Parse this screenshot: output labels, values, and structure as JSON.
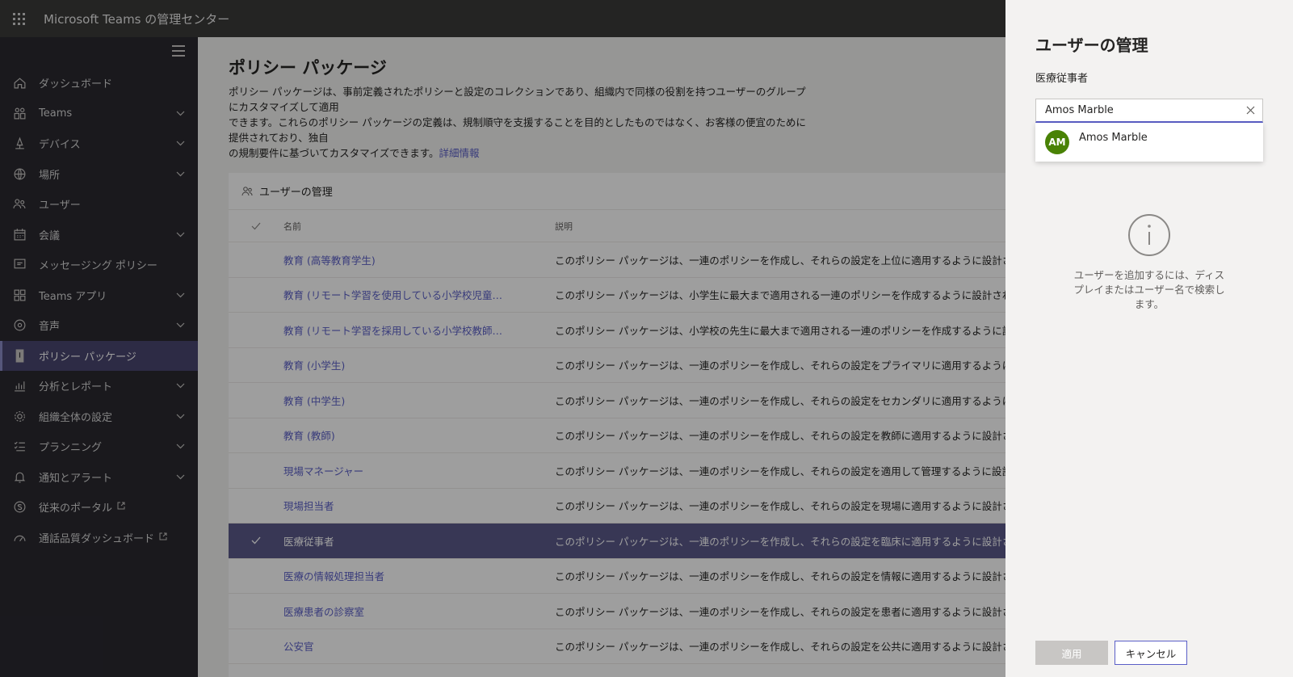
{
  "app": {
    "title": "Microsoft Teams の管理センター"
  },
  "sidebar": {
    "items": [
      {
        "label": "ダッシュボード",
        "icon": "home-icon",
        "expandable": false
      },
      {
        "label": "Teams",
        "icon": "teams-icon",
        "expandable": true
      },
      {
        "label": "デバイス",
        "icon": "devices-icon",
        "expandable": true
      },
      {
        "label": "場所",
        "icon": "globe-icon",
        "expandable": true
      },
      {
        "label": "ユーザー",
        "icon": "users-icon",
        "expandable": false
      },
      {
        "label": "会議",
        "icon": "calendar-icon",
        "expandable": true
      },
      {
        "label": "メッセージング ポリシー",
        "icon": "message-icon",
        "expandable": false
      },
      {
        "label": "Teams アプリ",
        "icon": "apps-icon",
        "expandable": true
      },
      {
        "label": "音声",
        "icon": "phone-icon",
        "expandable": true
      },
      {
        "label": "ポリシー パッケージ",
        "icon": "package-icon",
        "expandable": false,
        "active": true
      },
      {
        "label": "分析とレポート",
        "icon": "chart-icon",
        "expandable": true
      },
      {
        "label": "組織全体の設定",
        "icon": "gear-icon",
        "expandable": true
      },
      {
        "label": "プランニング",
        "icon": "checklist-icon",
        "expandable": true
      },
      {
        "label": "通知とアラート",
        "icon": "bell-icon",
        "expandable": true
      },
      {
        "label": "従来のポータル",
        "icon": "skype-icon",
        "expandable": false,
        "external": true
      },
      {
        "label": "通話品質ダッシュボード",
        "icon": "gauge-icon",
        "expandable": false,
        "external": true
      }
    ]
  },
  "main": {
    "title": "ポリシー パッケージ",
    "desc_line1": "ポリシー パッケージは、事前定義されたポリシーと設定のコレクションであり、組織内で同様の役割を持つユーザーのグループにカスタマイズして適用",
    "desc_line2": "できます。これらのポリシー パッケージの定義は、規制順守を支援することを目的としたものではなく、お客様の便宜のために提供されており、独自",
    "desc_line3": "の規制要件に基づいてカスタマイズできます。",
    "learn_more": "詳細情報",
    "card_title": "ユーザーの管理",
    "columns": {
      "name": "名前",
      "desc": "説明"
    },
    "rows": [
      {
        "name": "教育 (高等教育学生)",
        "desc": "このポリシー パッケージは、一連のポリシーを作成し、それらの設定を上位に適用するように設計されています"
      },
      {
        "name": "教育 (リモート学習を使用している小学校児童…",
        "desc": "このポリシー パッケージは、小学生に最大まで適用される一連のポリシーを作成するように設計されています。"
      },
      {
        "name": "教育 (リモート学習を採用している小学校教師…",
        "desc": "このポリシー パッケージは、小学校の先生に最大まで適用される一連のポリシーを作成するように設計されています"
      },
      {
        "name": "教育 (小学生)",
        "desc": "このポリシー パッケージは、一連のポリシーを作成し、それらの設定をプライマリに適用するように設計されています"
      },
      {
        "name": "教育 (中学生)",
        "desc": "このポリシー パッケージは、一連のポリシーを作成し、それらの設定をセカンダリに適用するように設計されています"
      },
      {
        "name": "教育 (教師)",
        "desc": "このポリシー パッケージは、一連のポリシーを作成し、それらの設定を教師に適用するように設計されています"
      },
      {
        "name": "現場マネージャー",
        "desc": "このポリシー パッケージは、一連のポリシーを作成し、それらの設定を適用して管理するように設計されています"
      },
      {
        "name": "現場担当者",
        "desc": "このポリシー パッケージは、一連のポリシーを作成し、それらの設定を現場に適用するように設計されています"
      },
      {
        "name": "医療従事者",
        "desc": "このポリシー パッケージは、一連のポリシーを作成し、それらの設定を臨床に適用するように設計されています",
        "selected": true
      },
      {
        "name": "医療の情報処理担当者",
        "desc": "このポリシー パッケージは、一連のポリシーを作成し、それらの設定を情報に適用するように設計されています"
      },
      {
        "name": "医療患者の診察室",
        "desc": "このポリシー パッケージは、一連のポリシーを作成し、それらの設定を患者に適用するように設計されています"
      },
      {
        "name": "公安官",
        "desc": "このポリシー パッケージは、一連のポリシーを作成し、それらの設定を公共に適用するように設計されています"
      }
    ]
  },
  "panel": {
    "title": "ユーザーの管理",
    "subtitle": "医療従事者",
    "search_value": "Amos Marble",
    "result": {
      "initials": "AM",
      "name": "Amos Marble"
    },
    "info_text": "ユーザーを追加するには、ディスプレイまたはユーザー名で検索します。",
    "apply_label": "適用",
    "cancel_label": "キャンセル"
  },
  "colors": {
    "accent": "#5b5fc7",
    "avatar": "#498205",
    "sidebar": "#2a2930",
    "topbar": "#3b3a39"
  }
}
